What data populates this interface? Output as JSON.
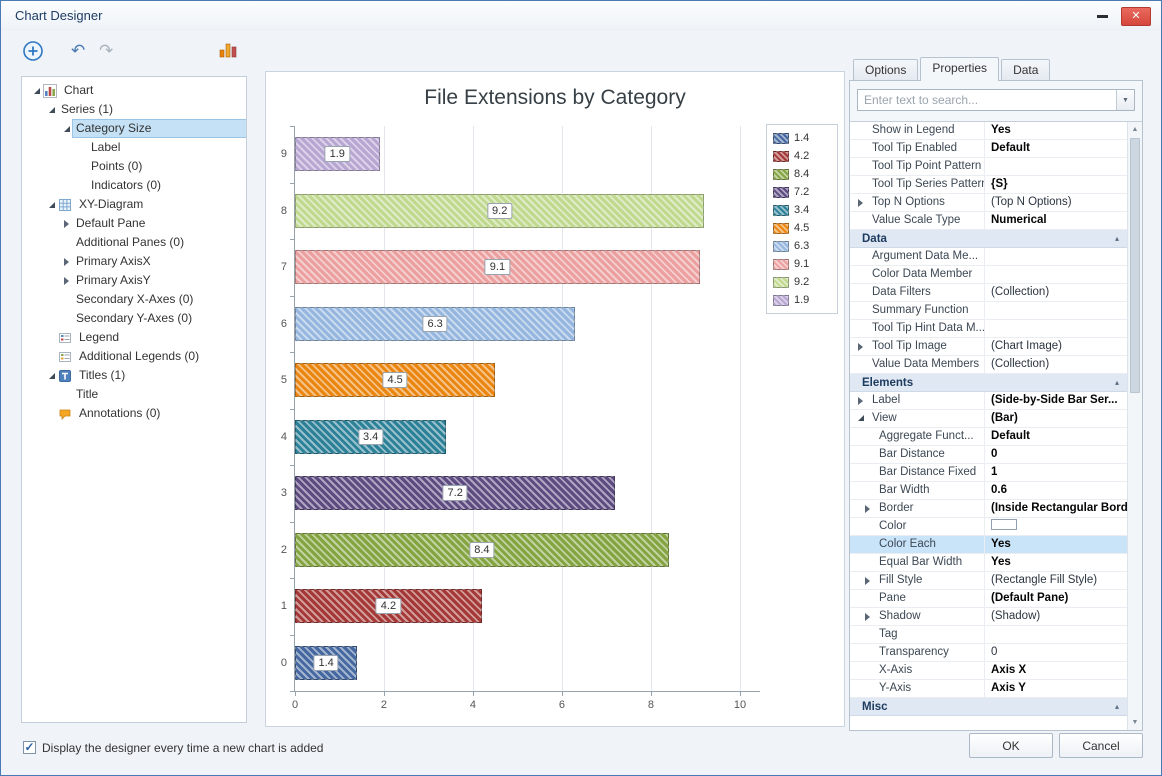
{
  "window": {
    "title": "Chart Designer",
    "footer_checkbox_label": "Display the designer every time a new chart is added",
    "footer_checkbox_checked": true,
    "ok_label": "OK",
    "cancel_label": "Cancel"
  },
  "toolbar": {
    "buttons": [
      "add-chart-element",
      "undo",
      "redo",
      "palette"
    ]
  },
  "tree": {
    "items": [
      {
        "label": "Chart",
        "level": 0,
        "expand": "expanded",
        "icon": "chart"
      },
      {
        "label": "Series (1)",
        "level": 1,
        "expand": "expanded"
      },
      {
        "label": "Category Size",
        "level": 2,
        "expand": "expanded",
        "selected": true
      },
      {
        "label": "Label",
        "level": 3
      },
      {
        "label": "Points (0)",
        "level": 3
      },
      {
        "label": "Indicators (0)",
        "level": 3
      },
      {
        "label": "XY-Diagram",
        "level": 1,
        "expand": "expanded",
        "icon": "diagram"
      },
      {
        "label": "Default Pane",
        "level": 2,
        "expand": "collapsed"
      },
      {
        "label": "Additional Panes (0)",
        "level": 2
      },
      {
        "label": "Primary AxisX",
        "level": 2,
        "expand": "collapsed"
      },
      {
        "label": "Primary AxisY",
        "level": 2,
        "expand": "collapsed"
      },
      {
        "label": "Secondary X-Axes (0)",
        "level": 2
      },
      {
        "label": "Secondary Y-Axes (0)",
        "level": 2
      },
      {
        "label": "Legend",
        "level": 1,
        "icon": "legend"
      },
      {
        "label": "Additional Legends (0)",
        "level": 1,
        "icon": "legend-add"
      },
      {
        "label": "Titles (1)",
        "level": 1,
        "expand": "expanded",
        "icon": "title"
      },
      {
        "label": "Title",
        "level": 2
      },
      {
        "label": "Annotations (0)",
        "level": 1,
        "icon": "annotation"
      }
    ]
  },
  "chart_data": {
    "type": "bar",
    "orientation": "horizontal",
    "title": "File Extensions by Category",
    "categories": [
      0,
      1,
      2,
      3,
      4,
      5,
      6,
      7,
      8,
      9
    ],
    "values": [
      1.4,
      4.2,
      8.4,
      7.2,
      3.4,
      4.5,
      6.3,
      9.1,
      9.2,
      1.9
    ],
    "colors": [
      "#44689f",
      "#a43836",
      "#83a440",
      "#5c4a80",
      "#2c8198",
      "#ea850f",
      "#94b6df",
      "#eb9f9e",
      "#bfd98f",
      "#b7a5d2"
    ],
    "bar_width_ratio": 0.6,
    "xlim": [
      0,
      10.45
    ],
    "x_ticks": [
      0,
      2,
      4,
      6,
      8,
      10
    ],
    "grid": true,
    "bar_labels_visible": true,
    "legend_position": "top-right",
    "legend_labels": [
      "1.4",
      "4.2",
      "8.4",
      "7.2",
      "3.4",
      "4.5",
      "6.3",
      "9.1",
      "9.2",
      "1.9"
    ]
  },
  "right_panel": {
    "tabs": [
      {
        "label": "Options",
        "active": false
      },
      {
        "label": "Properties",
        "active": true
      },
      {
        "label": "Data",
        "active": false
      }
    ],
    "search_placeholder": "Enter text to search...",
    "rows": [
      {
        "kind": "prop",
        "name": "Show in Legend",
        "value": "Yes",
        "bold": true
      },
      {
        "kind": "prop",
        "name": "Tool Tip Enabled",
        "value": "Default",
        "bold": true
      },
      {
        "kind": "prop",
        "name": "Tool Tip Point Pattern",
        "value": ""
      },
      {
        "kind": "prop",
        "name": "Tool Tip Series Pattern",
        "value": "{S}",
        "bold": true
      },
      {
        "kind": "prop",
        "name": "Top N Options",
        "value": "(Top N Options)",
        "expand": "collapsed"
      },
      {
        "kind": "prop",
        "name": "Value Scale Type",
        "value": "Numerical",
        "bold": true
      },
      {
        "kind": "category",
        "name": "Data"
      },
      {
        "kind": "prop",
        "name": "Argument Data Me...",
        "value": ""
      },
      {
        "kind": "prop",
        "name": "Color Data Member",
        "value": ""
      },
      {
        "kind": "prop",
        "name": "Data Filters",
        "value": "(Collection)"
      },
      {
        "kind": "prop",
        "name": "Summary Function",
        "value": ""
      },
      {
        "kind": "prop",
        "name": "Tool Tip Hint Data M...",
        "value": ""
      },
      {
        "kind": "prop",
        "name": "Tool Tip Image",
        "value": "(Chart Image)",
        "expand": "collapsed"
      },
      {
        "kind": "prop",
        "name": "Value Data Members",
        "value": "(Collection)"
      },
      {
        "kind": "category",
        "name": "Elements"
      },
      {
        "kind": "prop",
        "name": "Label",
        "value": "(Side-by-Side Bar Ser...",
        "bold": true,
        "expand": "collapsed"
      },
      {
        "kind": "prop",
        "name": "View",
        "value": "(Bar)",
        "bold": true,
        "expand": "expanded"
      },
      {
        "kind": "prop",
        "name": "Aggregate Funct...",
        "value": "Default",
        "bold": true,
        "indent": 1
      },
      {
        "kind": "prop",
        "name": "Bar Distance",
        "value": "0",
        "bold": true,
        "indent": 1
      },
      {
        "kind": "prop",
        "name": "Bar Distance Fixed",
        "value": "1",
        "bold": true,
        "indent": 1
      },
      {
        "kind": "prop",
        "name": "Bar Width",
        "value": "0.6",
        "bold": true,
        "indent": 1
      },
      {
        "kind": "prop",
        "name": "Border",
        "value": "(Inside Rectangular Bord...",
        "bold": true,
        "expand": "collapsed",
        "indent": 1
      },
      {
        "kind": "prop",
        "name": "Color",
        "value": "",
        "swatch": true,
        "indent": 1
      },
      {
        "kind": "prop",
        "name": "Color Each",
        "value": "Yes",
        "bold": true,
        "indent": 1,
        "selected": true
      },
      {
        "kind": "prop",
        "name": "Equal Bar Width",
        "value": "Yes",
        "bold": true,
        "indent": 1
      },
      {
        "kind": "prop",
        "name": "Fill Style",
        "value": "(Rectangle Fill Style)",
        "expand": "collapsed",
        "indent": 1
      },
      {
        "kind": "prop",
        "name": "Pane",
        "value": "(Default Pane)",
        "bold": true,
        "indent": 1
      },
      {
        "kind": "prop",
        "name": "Shadow",
        "value": "(Shadow)",
        "expand": "collapsed",
        "indent": 1
      },
      {
        "kind": "prop",
        "name": "Tag",
        "value": "",
        "indent": 1
      },
      {
        "kind": "prop",
        "name": "Transparency",
        "value": "0",
        "indent": 1
      },
      {
        "kind": "prop",
        "name": "X-Axis",
        "value": "Axis X",
        "bold": true,
        "indent": 1
      },
      {
        "kind": "prop",
        "name": "Y-Axis",
        "value": "Axis Y",
        "bold": true,
        "indent": 1
      },
      {
        "kind": "category",
        "name": "Misc"
      }
    ]
  }
}
